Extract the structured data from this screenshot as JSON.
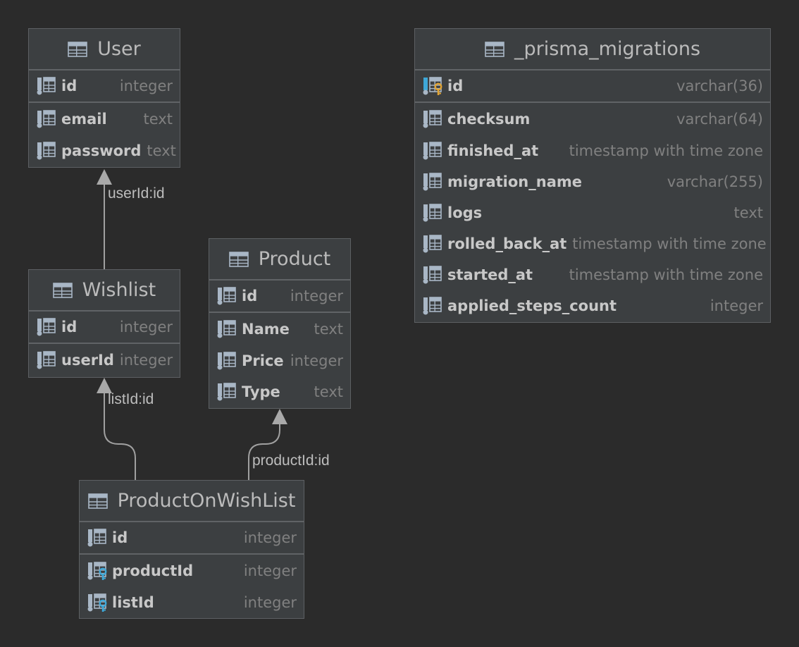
{
  "colors": {
    "background": "#2b2b2b",
    "table_fill": "#3c3f41",
    "table_border": "#5d6063",
    "key_blue": "#3ea8d8",
    "key_gold": "#e0a436"
  },
  "tables": {
    "user": {
      "title": "User",
      "columns": [
        {
          "name": "id",
          "type": "integer",
          "icon": "column-icon"
        },
        {
          "name": "email",
          "type": "text",
          "icon": "column-icon"
        },
        {
          "name": "password",
          "type": "text",
          "icon": "column-icon"
        }
      ]
    },
    "wishlist": {
      "title": "Wishlist",
      "columns": [
        {
          "name": "id",
          "type": "integer",
          "icon": "column-icon"
        },
        {
          "name": "userId",
          "type": "integer",
          "icon": "column-icon"
        }
      ]
    },
    "product": {
      "title": "Product",
      "columns": [
        {
          "name": "id",
          "type": "integer",
          "icon": "column-icon"
        },
        {
          "name": "Name",
          "type": "text",
          "icon": "column-icon"
        },
        {
          "name": "Price",
          "type": "integer",
          "icon": "column-icon"
        },
        {
          "name": "Type",
          "type": "text",
          "icon": "column-icon"
        }
      ]
    },
    "product_on_wishlist": {
      "title": "ProductOnWishList",
      "columns": [
        {
          "name": "id",
          "type": "integer",
          "icon": "column-icon"
        },
        {
          "name": "productId",
          "type": "integer",
          "icon": "foreign-key-column-icon"
        },
        {
          "name": "listId",
          "type": "integer",
          "icon": "foreign-key-column-icon"
        }
      ]
    },
    "prisma_migrations": {
      "title": "_prisma_migrations",
      "columns": [
        {
          "name": "id",
          "type": "varchar(36)",
          "icon": "primary-key-column-icon"
        },
        {
          "name": "checksum",
          "type": "varchar(64)",
          "icon": "column-icon"
        },
        {
          "name": "finished_at",
          "type": "timestamp with time zone",
          "icon": "column-icon"
        },
        {
          "name": "migration_name",
          "type": "varchar(255)",
          "icon": "column-icon"
        },
        {
          "name": "logs",
          "type": "text",
          "icon": "column-icon"
        },
        {
          "name": "rolled_back_at",
          "type": "timestamp with time zone",
          "icon": "column-icon"
        },
        {
          "name": "started_at",
          "type": "timestamp with time zone",
          "icon": "column-icon"
        },
        {
          "name": "applied_steps_count",
          "type": "integer",
          "icon": "column-icon"
        }
      ]
    }
  },
  "relations": [
    {
      "from": "Wishlist",
      "to": "User",
      "label": "userId:id"
    },
    {
      "from": "ProductOnWishList",
      "to": "Wishlist",
      "label": "listId:id"
    },
    {
      "from": "ProductOnWishList",
      "to": "Product",
      "label": "productId:id"
    }
  ]
}
